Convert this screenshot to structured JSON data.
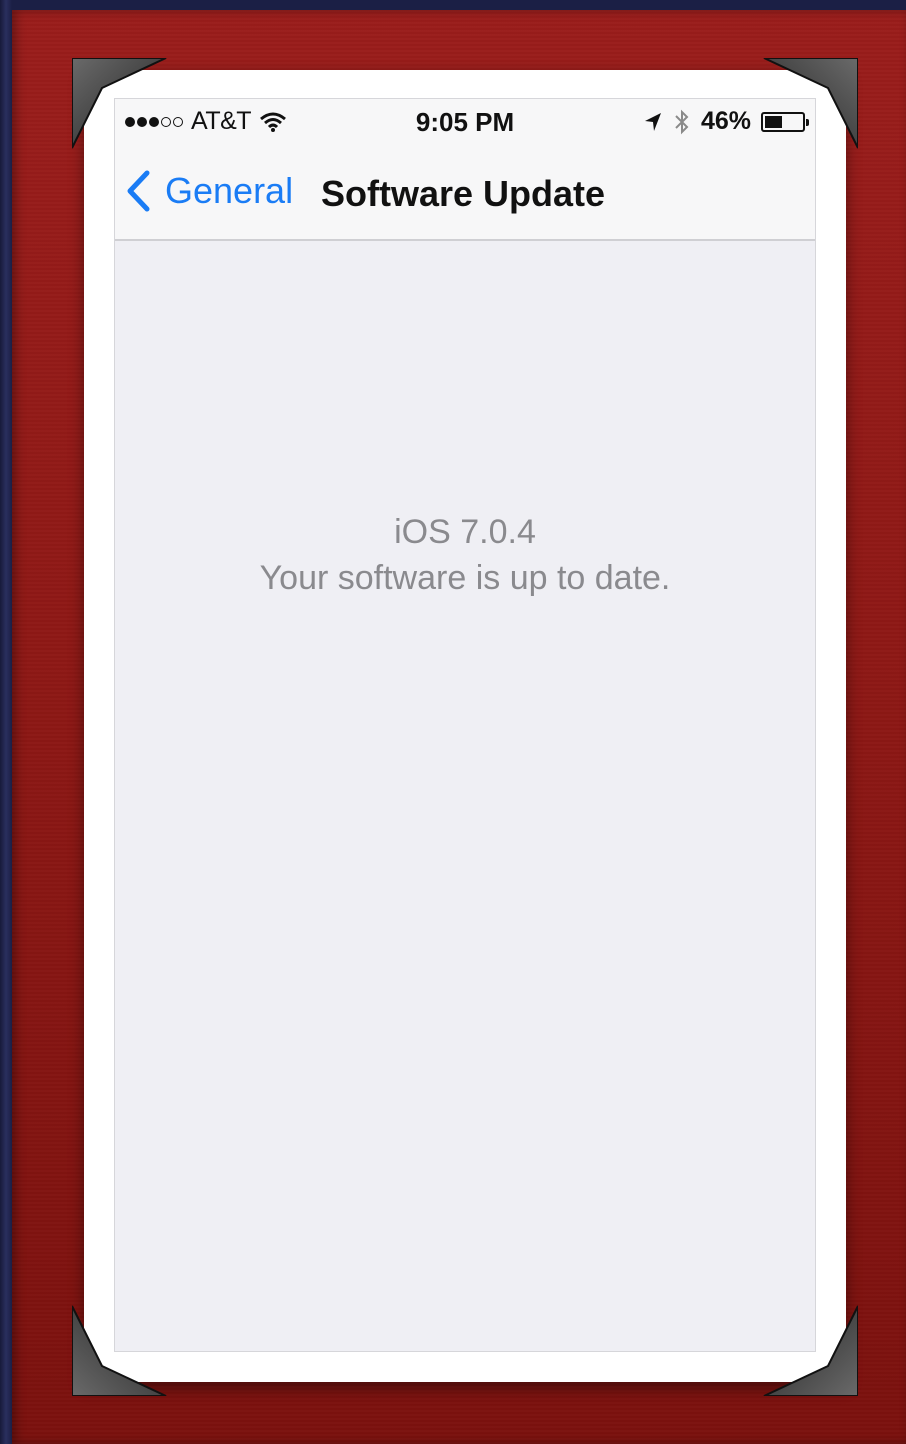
{
  "status_bar": {
    "carrier": "AT&T",
    "time": "9:05 PM",
    "battery_percent": "46%",
    "battery_level": 0.46,
    "signal_bars": 3,
    "signal_total": 5,
    "icons": [
      "wifi-icon",
      "location-arrow-icon",
      "bluetooth-icon",
      "battery-icon"
    ]
  },
  "nav": {
    "back_label": "General",
    "title": "Software Update"
  },
  "content": {
    "version": "iOS 7.0.4",
    "status_message": "Your software is up to date."
  },
  "colors": {
    "accent": "#1a7cf5",
    "frame_red": "#8e1815",
    "screen_bg": "#efeff4",
    "message_gray": "#8a8a8e"
  }
}
